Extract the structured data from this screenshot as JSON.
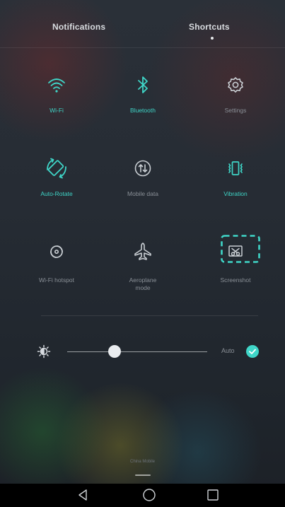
{
  "tabs": {
    "notifications": "Notifications",
    "shortcuts": "Shortcuts",
    "active": "Shortcuts"
  },
  "tiles": [
    {
      "label": "Wi-Fi",
      "icon": "wifi-icon",
      "state": "on"
    },
    {
      "label": "Bluetooth",
      "icon": "bluetooth-icon",
      "state": "on"
    },
    {
      "label": "Settings",
      "icon": "gear-icon",
      "state": "off"
    },
    {
      "label": "Auto-Rotate",
      "icon": "auto-rotate-icon",
      "state": "on"
    },
    {
      "label": "Mobile data",
      "icon": "mobile-data-icon",
      "state": "off"
    },
    {
      "label": "Vibration",
      "icon": "vibration-icon",
      "state": "on"
    },
    {
      "label": "Wi-Fi hotspot",
      "icon": "hotspot-icon",
      "state": "off"
    },
    {
      "label": "Aeroplane\nmode",
      "icon": "airplane-icon",
      "state": "off"
    },
    {
      "label": "Screenshot",
      "icon": "screenshot-icon",
      "state": "off",
      "highlighted": true
    }
  ],
  "brightness": {
    "icon": "brightness-icon",
    "level": 0.34,
    "auto_label": "Auto",
    "auto_checked": true
  },
  "carrier": "China Mobile",
  "navbar": {
    "back": "back-icon",
    "home": "home-icon",
    "recent": "recent-apps-icon"
  },
  "colors": {
    "active": "#3fd6c8",
    "inactive": "#8a9097",
    "highlight_box": "#3fd6c8"
  }
}
